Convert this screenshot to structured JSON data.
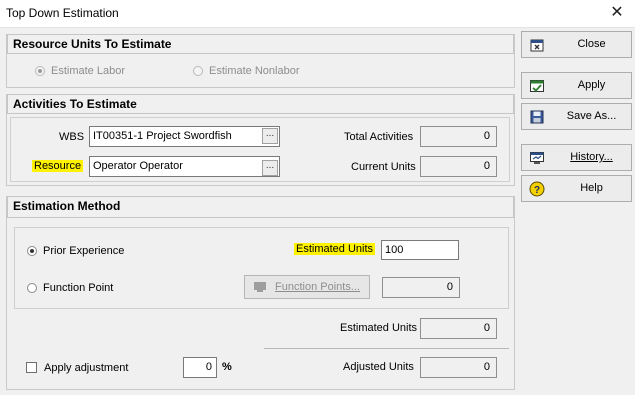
{
  "window": {
    "title": "Top Down Estimation",
    "close_glyph": "✕"
  },
  "resource_units": {
    "header": "Resource Units To Estimate",
    "labor_label": "Estimate Labor",
    "nonlabor_label": "Estimate Nonlabor"
  },
  "activities": {
    "header": "Activities To Estimate",
    "wbs_label": "WBS",
    "wbs_value": "IT00351-1  Project Swordfish",
    "resource_label": "Resource",
    "resource_value": "Operator  Operator",
    "browse_label": "...",
    "total_label": "Total Activities",
    "total_value": "0",
    "current_label": "Current Units",
    "current_value": "0"
  },
  "method": {
    "header": "Estimation Method",
    "prior_label": "Prior Experience",
    "function_label": "Function Point",
    "est_units_label": "Estimated Units",
    "est_units_value": "100",
    "fp_button_label": "Function Points...",
    "fp_value": "0",
    "estimated_units_label": "Estimated Units",
    "estimated_units_value": "0",
    "apply_adj_label": "Apply adjustment",
    "adj_value": "0",
    "pct_label": "%",
    "adjusted_label": "Adjusted Units",
    "adjusted_value": "0"
  },
  "sidebar": {
    "close": "Close",
    "apply": "Apply",
    "save_as": "Save As...",
    "history": "History...",
    "help": "Help"
  },
  "colors": {
    "highlight": "#fff200",
    "dialog_bg": "#f0f0f0"
  },
  "icons": [
    "close-dialog-icon",
    "apply-icon",
    "save-disk-icon",
    "history-icon",
    "help-icon"
  ]
}
